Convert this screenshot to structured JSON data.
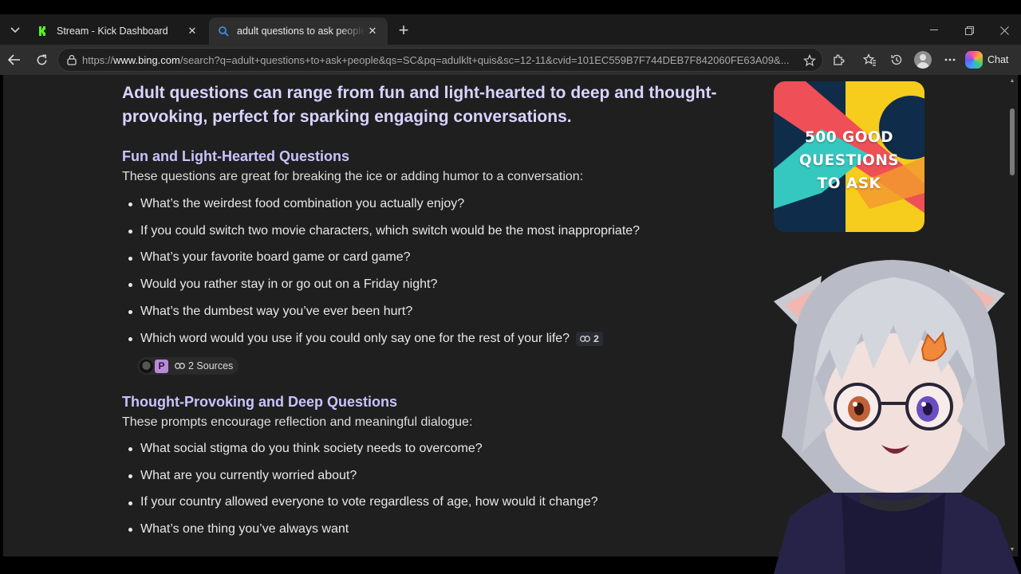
{
  "browser": {
    "tabs": [
      {
        "title": "Stream - Kick Dashboard",
        "favicon": "kick-icon",
        "active": false
      },
      {
        "title": "adult questions to ask people - Search",
        "favicon": "bing-search-icon",
        "active": true
      }
    ],
    "url_prefix": "https://",
    "url_host": "www.bing.com",
    "url_rest": "/search?q=adult+questions+to+ask+people&qs=SC&pq=adulklt+quis&sc=12-11&cvid=101EC559B7F744DEB7F842060FE63A09&...",
    "chat_label": "Chat"
  },
  "answer": {
    "heading": "Adult questions can range from fun and light-hearted to deep and thought-provoking, perfect for sparking engaging conversations.",
    "sections": [
      {
        "title": "Fun and Light-Hearted Questions",
        "description": "These questions are great for breaking the ice or adding humor to a conversation:",
        "questions": [
          "What’s the weirdest food combination you actually enjoy?",
          "If you could switch two movie characters, which switch would be the most inappropriate?",
          "What’s your favorite board game or card game?",
          "Would you rather stay in or go out on a Friday night?",
          "What’s the dumbest way you’ve ever been hurt?",
          "Which word would you use if you could only say one for the rest of your life?"
        ],
        "last_citation_count": "2",
        "sources_label": "2 Sources",
        "source_icon_letter": "P"
      },
      {
        "title": "Thought-Provoking and Deep Questions",
        "description": "These prompts encourage reflection and meaningful dialogue:",
        "questions": [
          "What social stigma do you think society needs to overcome?",
          "What are you currently worried about?",
          "If your country allowed everyone to vote regardless of age, how would it change?",
          "What’s one thing you’ve always want"
        ]
      }
    ]
  },
  "thumbnail": {
    "lines": [
      "500 GOOD",
      "QUESTIONS",
      "TO ASK"
    ],
    "colors": {
      "navy": "#0f2d4a",
      "red": "#ef4f57",
      "yellow": "#f6cc1d",
      "teal": "#35c8c0",
      "orange": "#f29a2e"
    }
  },
  "colors": {
    "heading": "#d9d4ff",
    "section_title": "#c9c2ff",
    "page_bg": "#1f1f1f",
    "chrome_bg": "#2e2e2e"
  }
}
